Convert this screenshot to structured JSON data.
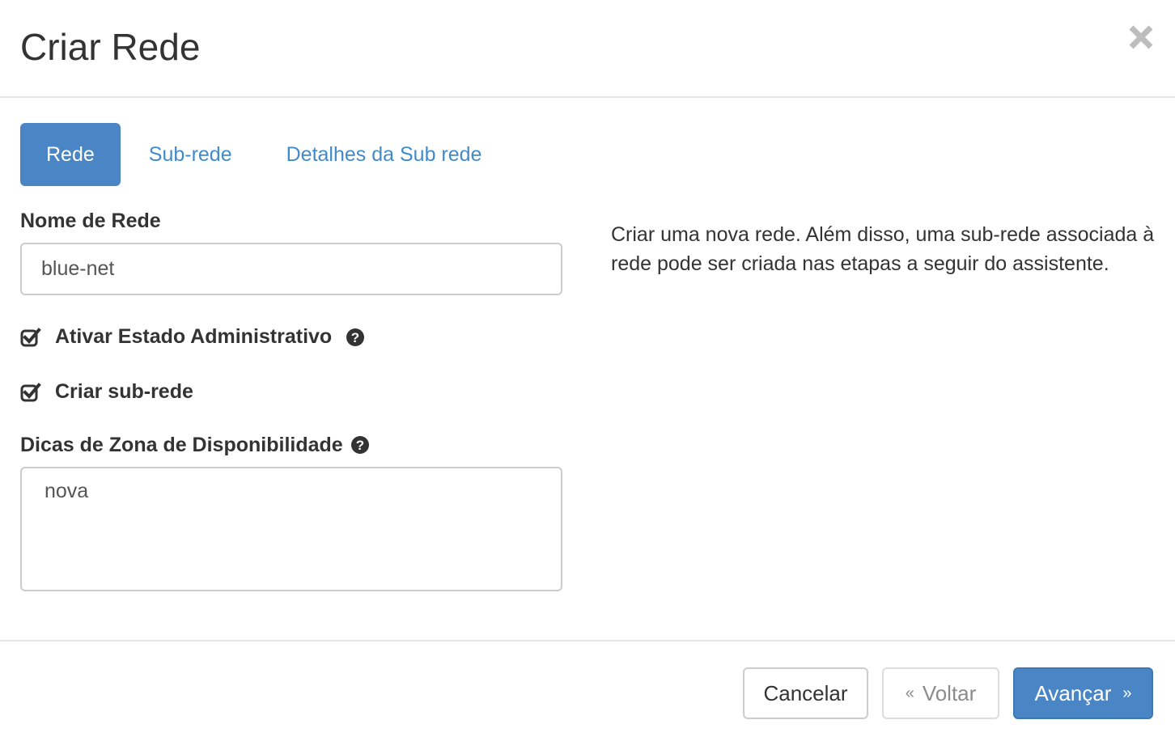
{
  "modal": {
    "title": "Criar Rede",
    "close_icon": "close-icon"
  },
  "tabs": [
    {
      "label": "Rede",
      "active": true
    },
    {
      "label": "Sub-rede",
      "active": false
    },
    {
      "label": "Detalhes da Sub rede",
      "active": false
    }
  ],
  "form": {
    "network_name_label": "Nome de Rede",
    "network_name_value": "blue-net",
    "admin_state_label": "Ativar Estado Administrativo",
    "admin_state_checked": true,
    "create_subnet_label": "Criar sub-rede",
    "create_subnet_checked": true,
    "az_hints_label": "Dicas de Zona de Disponibilidade",
    "az_hints_options": [
      "nova"
    ]
  },
  "description": "Criar uma nova rede. Além disso, uma sub-rede associada à rede pode ser criada nas etapas a seguir do assistente.",
  "footer": {
    "cancel_label": "Cancelar",
    "back_label": "Voltar",
    "back_chevron": "«",
    "next_label": "Avançar",
    "next_chevron": "»"
  },
  "colors": {
    "primary": "#4a86c5",
    "link": "#428bca",
    "border": "#cccccc",
    "text": "#333333"
  }
}
